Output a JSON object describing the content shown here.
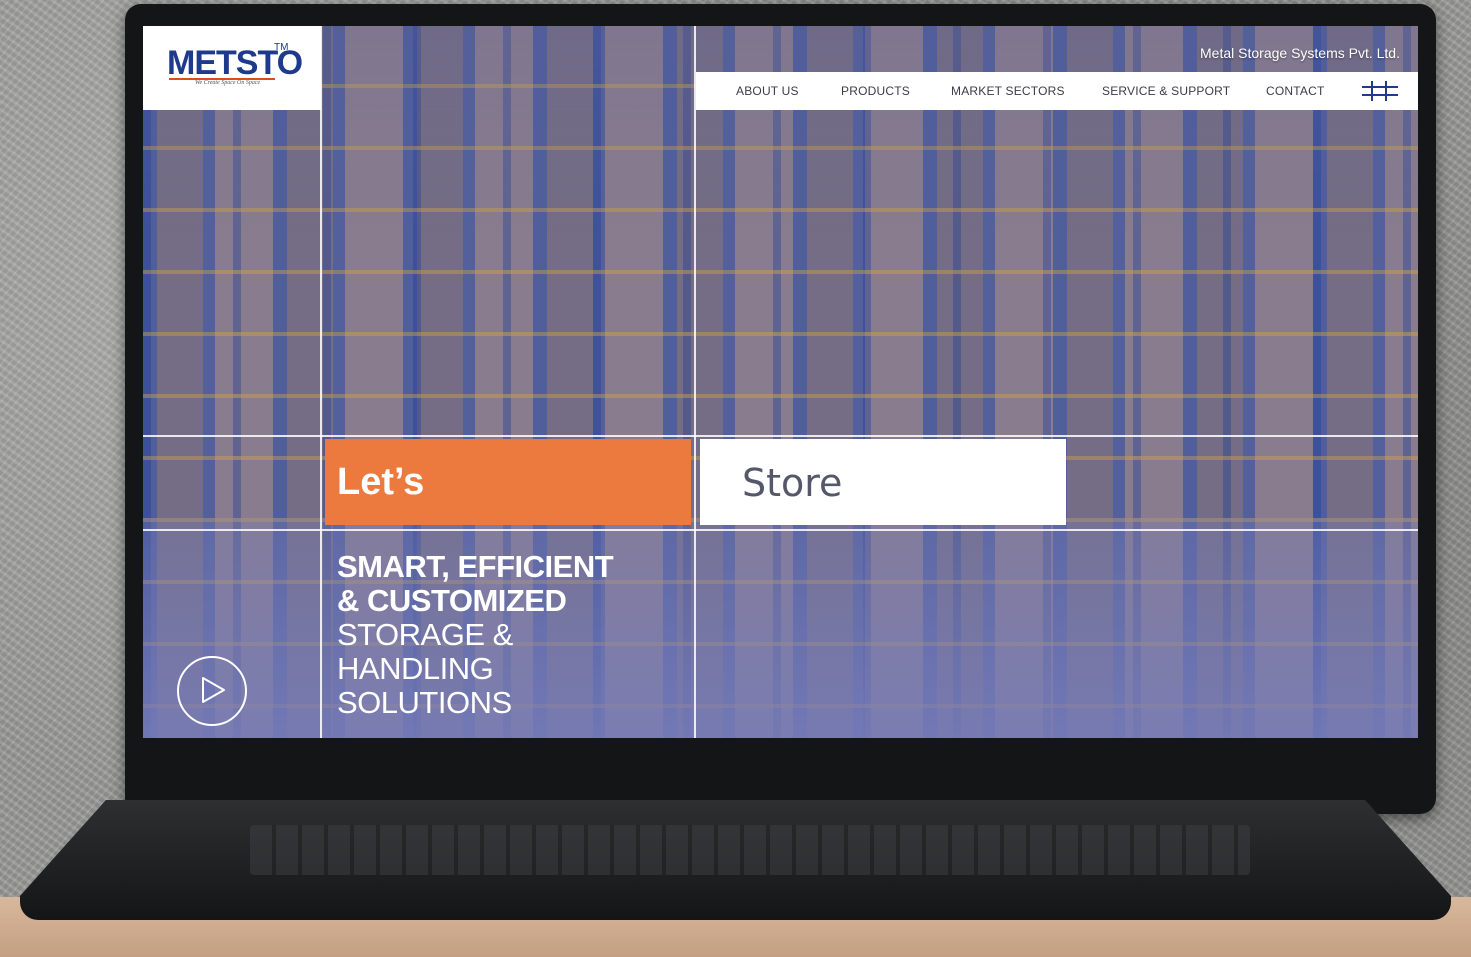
{
  "brand": {
    "logo_text": "METSTO",
    "logo_tm": "TM",
    "logo_tagline": "We Create Space On Space",
    "company_name": "Metal Storage Systems Pvt. Ltd."
  },
  "nav": {
    "items": [
      {
        "label": "ABOUT US"
      },
      {
        "label": "PRODUCTS"
      },
      {
        "label": "MARKET SECTORS"
      },
      {
        "label": "SERVICE & SUPPORT"
      },
      {
        "label": "CONTACT"
      }
    ],
    "menu_icon": "hash-grid-icon"
  },
  "hero": {
    "word1": "Let’s",
    "word2": "Store",
    "tagline_bold_1": "SMART, EFFICIENT",
    "tagline_bold_2": "& CUSTOMIZED",
    "tagline_thin_1": "STORAGE &",
    "tagline_thin_2": "HANDLING",
    "tagline_thin_3": "SOLUTIONS",
    "play_icon": "play-icon"
  },
  "colors": {
    "accent": "#ec7a3e",
    "brand_blue": "#1e3a8c",
    "overlay": "#6e6eaa"
  }
}
